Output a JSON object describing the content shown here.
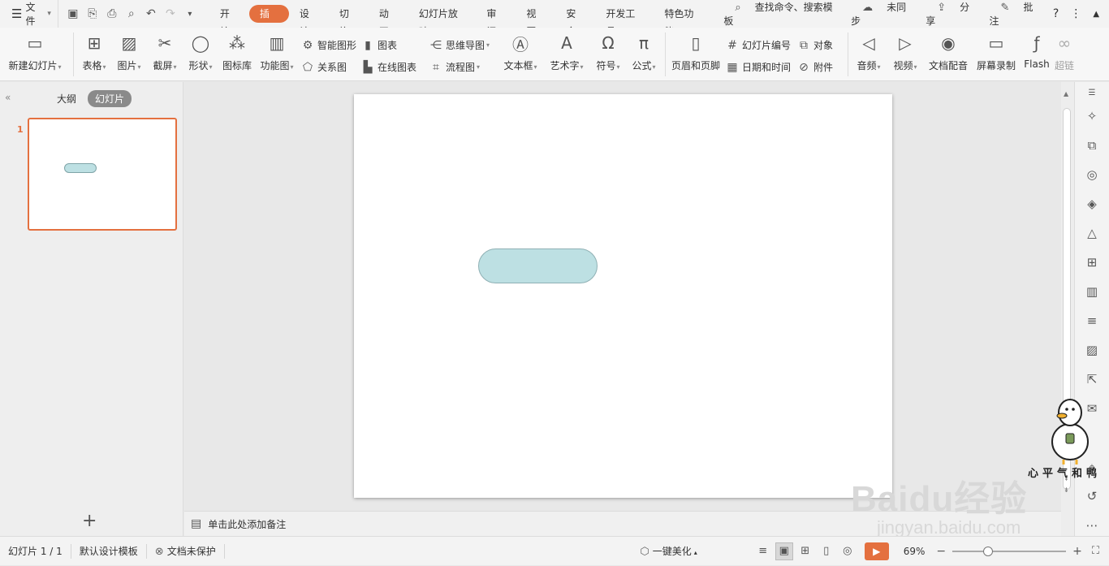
{
  "app": {
    "accent": "#e4703f",
    "slide_shape_fill": "#bde0e3"
  },
  "topbar": {
    "file": "文件",
    "tabs": [
      "开始",
      "插入",
      "设计",
      "切换",
      "动画",
      "幻灯片放映",
      "审阅",
      "视图",
      "安全",
      "开发工具",
      "特色功能"
    ],
    "active_tab": "插入",
    "search": "查找命令、搜索模板",
    "sync": "未同步",
    "share": "分享",
    "comment": "批注"
  },
  "ribbon": {
    "new_slide": "新建幻灯片",
    "table": "表格",
    "picture": "图片",
    "screenshot": "截屏",
    "shape": "形状",
    "icon_lib": "图标库",
    "func_chart": "功能图",
    "smart_art": "智能图形",
    "chart": "图表",
    "relation": "关系图",
    "online_chart": "在线图表",
    "mind_map": "思维导图",
    "flowchart": "流程图",
    "textbox": "文本框",
    "wordart": "艺术字",
    "symbol": "符号",
    "formula": "公式",
    "header_footer": "页眉和页脚",
    "slide_number": "幻灯片编号",
    "object": "对象",
    "date_time": "日期和时间",
    "attachment": "附件",
    "audio": "音频",
    "video": "视频",
    "doc_dub": "文档配音",
    "screen_record": "屏幕录制",
    "flash": "Flash",
    "hyperlink": "超链"
  },
  "left_panel": {
    "outline_tab": "大纲",
    "slides_tab": "幻灯片",
    "slide_number": "1"
  },
  "notes": {
    "placeholder": "单击此处添加备注"
  },
  "status": {
    "slide_count": "幻灯片 1 / 1",
    "template": "默认设计模板",
    "protect": "文档未保护",
    "beautify": "一键美化",
    "zoom": "69%"
  },
  "watermark": {
    "brand": "Baidu经验",
    "url": "jingyan.baidu.com",
    "mascot_text": "心平气和鸭"
  }
}
